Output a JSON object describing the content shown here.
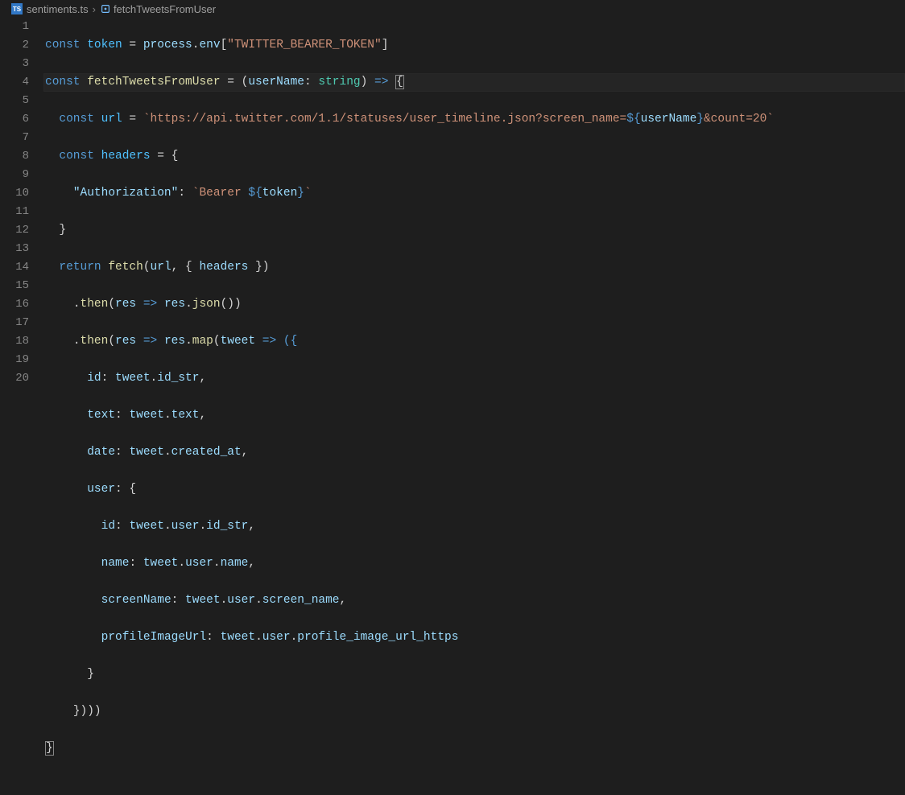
{
  "breadcrumbs": {
    "file_icon": "TS",
    "file_name": "sentiments.ts",
    "symbol_name": "fetchTweetsFromUser"
  },
  "gutter": [
    "1",
    "2",
    "3",
    "4",
    "5",
    "6",
    "7",
    "8",
    "9",
    "10",
    "11",
    "12",
    "13",
    "14",
    "15",
    "16",
    "17",
    "18",
    "19",
    "20"
  ],
  "code": {
    "l1": {
      "kw1": "const",
      "var": "token",
      "eq": " = ",
      "obj": "process",
      "d1": ".",
      "p1": "env",
      "b1": "[",
      "s": "\"TWITTER_BEARER_TOKEN\"",
      "b2": "]"
    },
    "l2": {
      "kw1": "const",
      "fn": "fetchTweetsFromUser",
      "eq": " = (",
      "param": "userName",
      "colon": ": ",
      "type": "string",
      "close": ") ",
      "arrow": "=>",
      "brace": " {"
    },
    "l3": {
      "kw": "const",
      "v": "url",
      "eq": " = ",
      "s1": "`https://api.twitter.com/1.1/statuses/user_timeline.json?screen_name=",
      "i1": "${",
      "iv": "userName",
      "i2": "}",
      "s2": "&count=20`"
    },
    "l4": {
      "kw": "const",
      "v": "headers",
      "rest": " = {"
    },
    "l5": {
      "k": "\"Authorization\"",
      "c": ": ",
      "s1": "`Bearer ",
      "i1": "${",
      "iv": "token",
      "i2": "}",
      "s2": "`"
    },
    "l6": {
      "b": "}"
    },
    "l7": {
      "kw": "return",
      "fn": "fetch",
      "a": "(",
      "v": "url",
      "rest": ", { ",
      "p": "headers",
      "end": " })"
    },
    "l8": {
      "d": ".",
      "fn": "then",
      "a": "(",
      "p": "res",
      "ar": " => ",
      "v": "res",
      "d2": ".",
      "fn2": "json",
      "end": "())"
    },
    "l9": {
      "d": ".",
      "fn": "then",
      "a": "(",
      "p": "res",
      "ar": " => ",
      "v": "res",
      "d2": ".",
      "fn2": "map",
      "a2": "(",
      "p2": "tweet",
      "ar2": " => ({"
    },
    "l10": {
      "k": "id",
      "c": ": ",
      "v": "tweet",
      "d": ".",
      "p": "id_str",
      "e": ","
    },
    "l11": {
      "k": "text",
      "c": ": ",
      "v": "tweet",
      "d": ".",
      "p": "text",
      "e": ","
    },
    "l12": {
      "k": "date",
      "c": ": ",
      "v": "tweet",
      "d": ".",
      "p": "created_at",
      "e": ","
    },
    "l13": {
      "k": "user",
      "c": ": {"
    },
    "l14": {
      "k": "id",
      "c": ": ",
      "v": "tweet",
      "d": ".",
      "p1": "user",
      "d2": ".",
      "p2": "id_str",
      "e": ","
    },
    "l15": {
      "k": "name",
      "c": ": ",
      "v": "tweet",
      "d": ".",
      "p1": "user",
      "d2": ".",
      "p2": "name",
      "e": ","
    },
    "l16": {
      "k": "screenName",
      "c": ": ",
      "v": "tweet",
      "d": ".",
      "p1": "user",
      "d2": ".",
      "p2": "screen_name",
      "e": ","
    },
    "l17": {
      "k": "profileImageUrl",
      "c": ": ",
      "v": "tweet",
      "d": ".",
      "p1": "user",
      "d2": ".",
      "p2": "profile_image_url_https"
    },
    "l18": {
      "b": "}"
    },
    "l19": {
      "b": "})))"
    },
    "l20": {
      "b": "}"
    }
  }
}
